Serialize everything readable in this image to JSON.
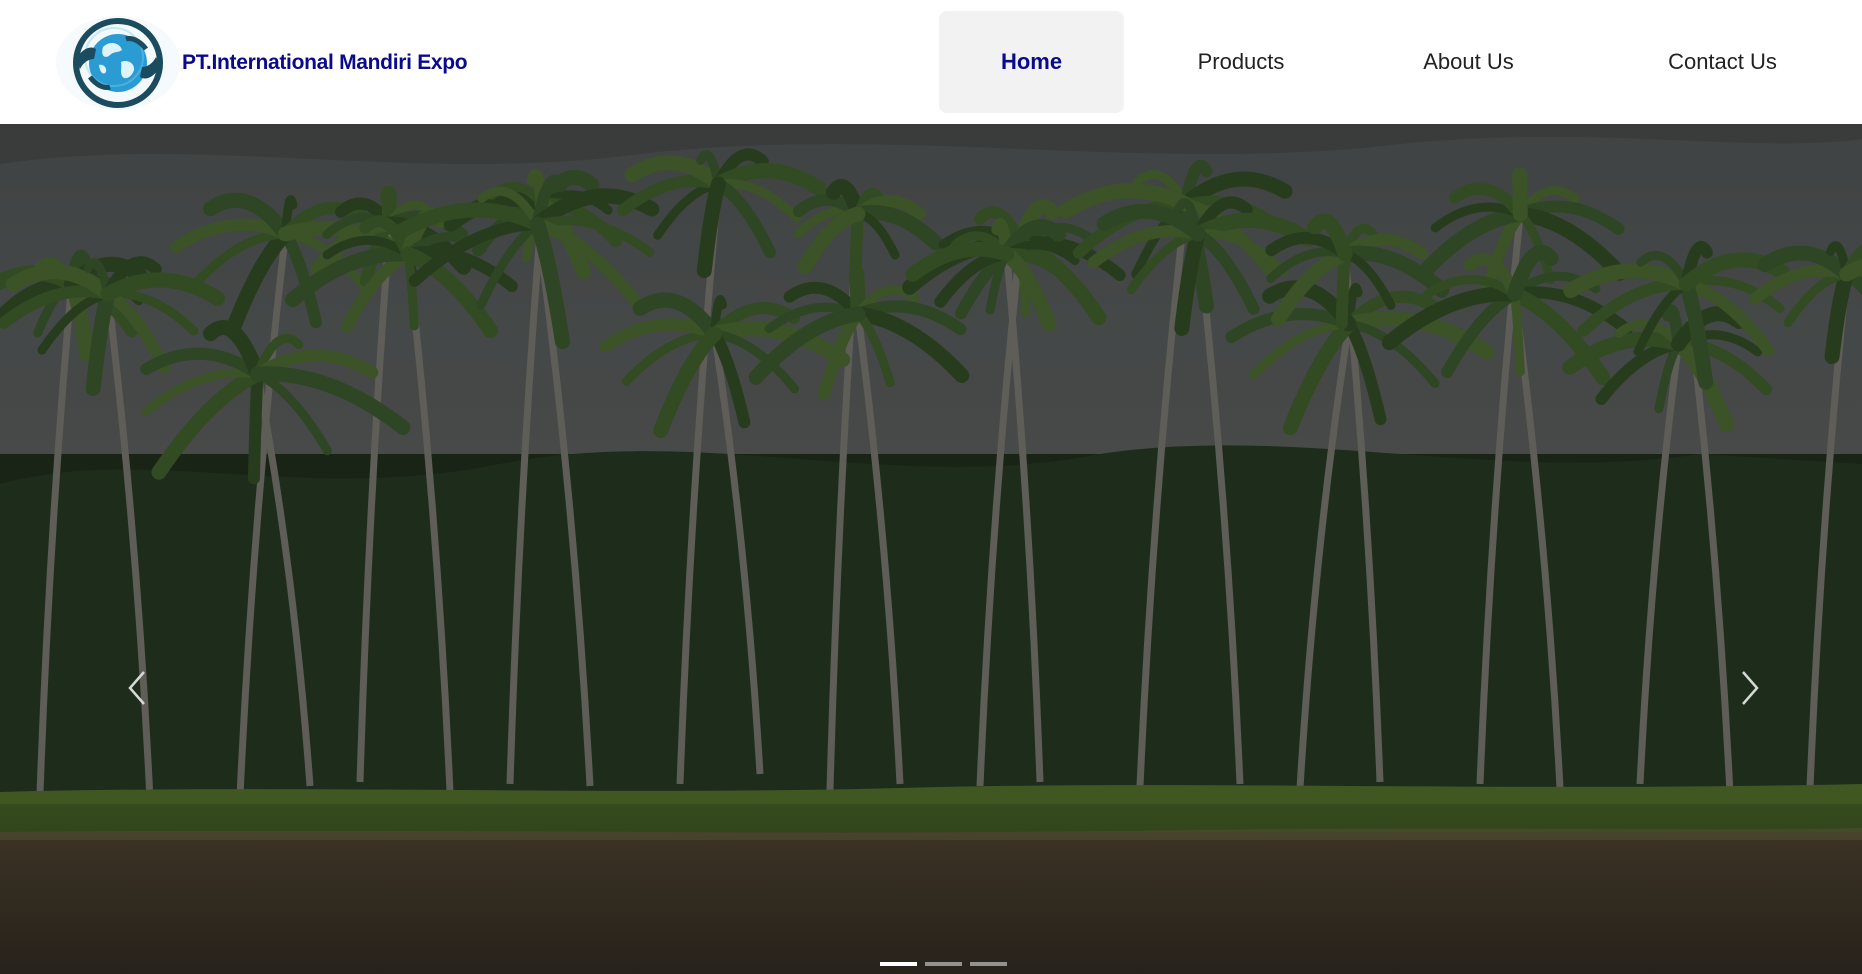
{
  "brand": {
    "name": "PT.International Mandiri Expo",
    "color": "#0a0a8c",
    "logo_icon": "globe-handshake-icon"
  },
  "nav": {
    "items": [
      {
        "label": "Home",
        "active": true
      },
      {
        "label": "Products",
        "active": false
      },
      {
        "label": "About Us",
        "active": false
      },
      {
        "label": "Contact Us",
        "active": false
      }
    ],
    "active_color": "#0a0a8c",
    "text_color": "#222222"
  },
  "carousel": {
    "slide_count": 3,
    "active_index": 0,
    "prev_icon": "chevron-left-icon",
    "next_icon": "chevron-right-icon",
    "image_subject": "coconut palm trees beside a river under an overcast sky"
  }
}
